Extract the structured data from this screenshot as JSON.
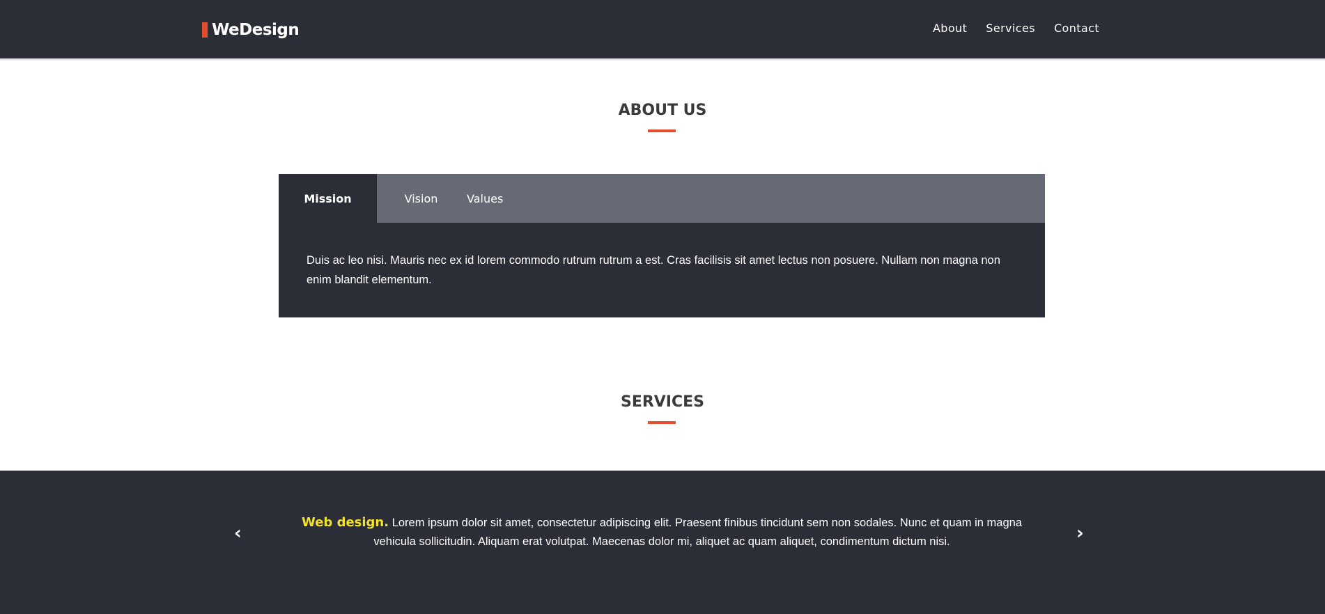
{
  "header": {
    "logo_text": "WeDesign",
    "nav": [
      "About",
      "Services",
      "Contact"
    ]
  },
  "about": {
    "title": "ABOUT US",
    "tabs": [
      "Mission",
      "Vision",
      "Values"
    ],
    "active_tab": "Mission",
    "content": "Duis ac leo nisi. Mauris nec ex id lorem commodo rutrum rutrum a est. Cras facilisis sit amet lectus non posuere. Nullam non magna non enim blandit elementum."
  },
  "services": {
    "title": "SERVICES",
    "carousel": {
      "prev_icon": "‹",
      "next_icon": "›",
      "item_name": "Web design.",
      "item_text": "Lorem ipsum dolor sit amet, consectetur adipiscing elit. Praesent finibus tincidunt sem non sodales. Nunc et quam in magna vehicula sollicitudin. Aliquam erat volutpat. Maecenas dolor mi, aliquet ac quam aliquet, condimentum dictum nisi."
    }
  },
  "colors": {
    "dark": "#2b2e36",
    "tab_strip": "#666a75",
    "accent": "#e44d2e",
    "highlight": "#f4e22c"
  }
}
